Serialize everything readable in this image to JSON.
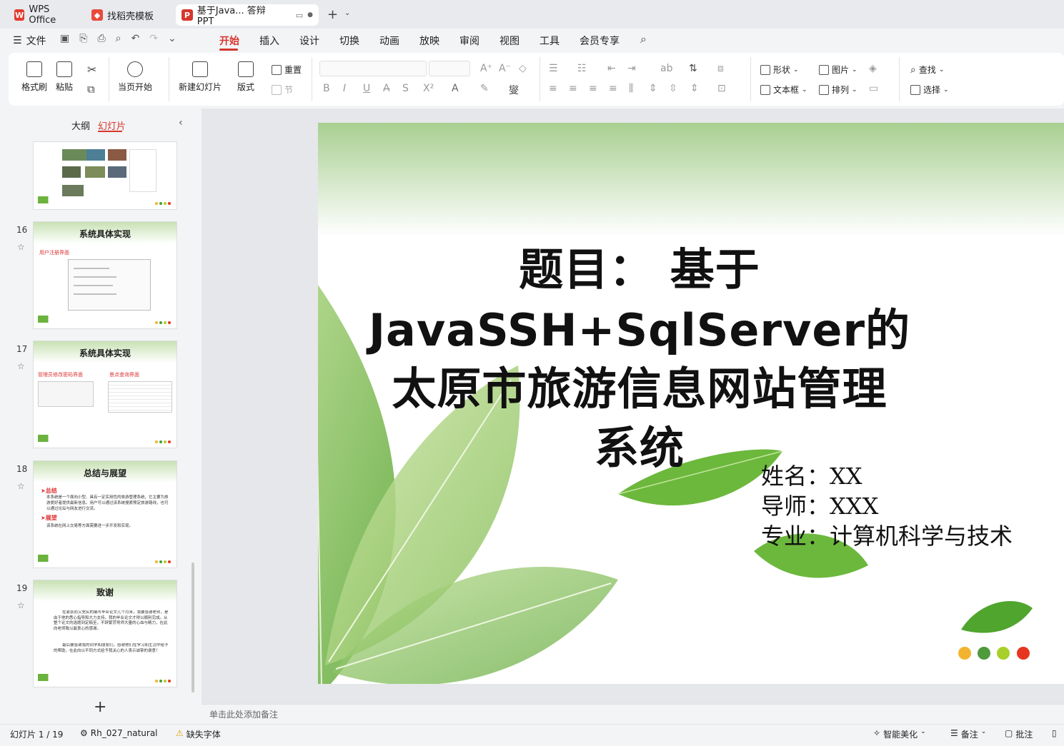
{
  "tabs": [
    {
      "label": "WPS Office",
      "icon": "wps-logo-icon"
    },
    {
      "label": "找稻壳模板",
      "icon": "docer-logo-icon"
    },
    {
      "label": "基于Java... 答辩PPT",
      "icon": "presentation-icon",
      "active": true
    }
  ],
  "menu": {
    "file": "文件",
    "items": [
      "开始",
      "插入",
      "设计",
      "切换",
      "动画",
      "放映",
      "审阅",
      "视图",
      "工具",
      "会员专享"
    ],
    "active": "开始"
  },
  "ribbon": {
    "format_painter": "格式刷",
    "paste": "粘贴",
    "start_from_current": "当页开始",
    "new_slide": "新建幻灯片",
    "layout": "版式",
    "reset": "重置",
    "section": "节",
    "shape": "形状",
    "picture": "图片",
    "find": "查找",
    "textbox": "文本框",
    "arrange": "排列",
    "select": "选择"
  },
  "left_panel": {
    "outline_tab": "大纲",
    "slides_tab": "幻灯片",
    "slides": [
      {
        "num": "16",
        "title": "系统具体实现",
        "bullet": "用户注册界面"
      },
      {
        "num": "17",
        "title": "系统具体实现",
        "bullet_left": "管理员修改密码界面",
        "bullet_right": "景点查询界面"
      },
      {
        "num": "18",
        "title": "总结与展望",
        "h1": "总结",
        "p1": "本系统是一个面向小型、具有一定实用性的旅游管理系统，它主要为旅游爱好者提供最新信息。用户可以通过该系统搜索预定旅游路线，也可以通过论坛与网友进行交流。",
        "h2": "展望",
        "p2": "该系统在网上交易等方面需要进一步开发和实现。"
      },
      {
        "num": "19",
        "title": "致谢",
        "p1": "在紧张而又充实的编写毕业论文几个月来，我要感谢老师，是由于他的悉心指导和大力支持，我的毕业论文才得以顺利完成。从整个论文的选题到定稿至，不辞繁劳导师大量的心血与精力，在此向老师致以最衷心的感谢。",
        "p2": "最后要感谢我的同学和朋友们，感谢他们在学习和生活中给予的帮助，在此向以不同方式给予我关心的人表示诚挚的谢意！"
      }
    ],
    "add_icon": "plus-icon"
  },
  "slide": {
    "title_lines": [
      "题目：  基于",
      "JavaSSH+SqlServer的",
      "太原市旅游信息网站管理",
      "系统"
    ],
    "name": "姓名：XX",
    "advisor": "导师：XXX",
    "major": "专业：计算机科学与技术",
    "dot_colors": [
      "#f2b430",
      "#4f9a3c",
      "#a8d02a",
      "#e8351f"
    ]
  },
  "notes_placeholder": "单击此处添加备注",
  "status": {
    "slide_index": "幻灯片 1 / 19",
    "theme": "Rh_027_natural",
    "missing_font": "缺失字体",
    "smart_beautify": "智能美化",
    "notes": "备注",
    "comments": "批注"
  }
}
